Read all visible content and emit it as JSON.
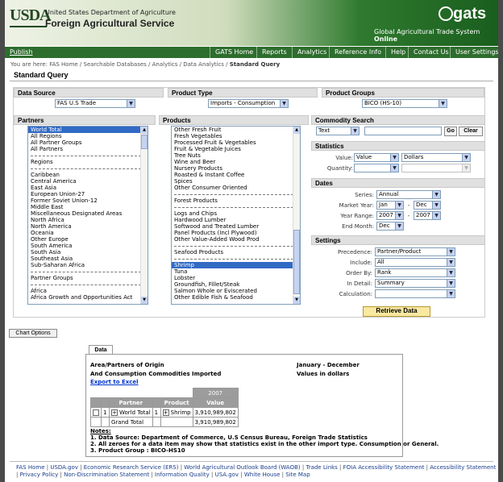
{
  "header": {
    "usda_logo_text": "USDA",
    "department": "United States Department of Agriculture",
    "agency": "Foreign Agricultural Service",
    "gats_logo_text": "gats",
    "gats_subtitle": "Global Agricultural Trade System",
    "gats_subtitle_bold": "Online",
    "brand_color": "#2d6d2d"
  },
  "nav": {
    "publish": "Publish",
    "items": [
      "GATS Home",
      "Reports",
      "Analytics",
      "Reference Info",
      "Help",
      "Contact Us",
      "User Settings"
    ]
  },
  "breadcrumb": {
    "prefix": "You are here: FAS Home / Searchable Databases / Analytics / Data Analytics / ",
    "current": "Standard Query"
  },
  "page_title": "Standard Query",
  "data_source": {
    "label": "Data Source",
    "value": "FAS U.S Trade"
  },
  "product_type": {
    "label": "Product Type",
    "value": "Imports - Consumption"
  },
  "product_groups": {
    "label": "Product Groups",
    "value": "BICO (HS-10)"
  },
  "partners": {
    "label": "Partners",
    "items": [
      "World Total",
      "All Regions",
      "All Partner Groups",
      "All Partners",
      "---",
      "Regions",
      "---",
      "Caribbean",
      "Central America",
      "East Asia",
      "European Union-27",
      "Former Soviet Union-12",
      "Middle East",
      "Miscellaneous Designated Areas",
      "North Africa",
      "North America",
      "Oceania",
      "Other Europe",
      "South America",
      "South Asia",
      "Southeast Asia",
      "Sub-Saharan Africa",
      "---",
      "Partner Groups",
      "---",
      "Africa",
      "Africa Growth and Opportunities Act"
    ],
    "selected": "World Total"
  },
  "products": {
    "label": "Products",
    "items": [
      "Other Fresh Fruit",
      "Fresh Vegetables",
      "Processed Fruit & Vegetables",
      "Fruit & Vegetable Juices",
      "Tree Nuts",
      "Wine and Beer",
      "Nursery Products",
      "Roasted & Instant Coffee",
      "Spices",
      "Other Consumer Oriented",
      "---",
      "Forest Products",
      "---",
      "Logs and Chips",
      "Hardwood Lumber",
      "Softwood and Treated Lumber",
      "Panel Products (Incl Plywood)",
      "Other Value-Added Wood Prod",
      "---",
      "Seafood Products",
      "---",
      "Shrimp",
      "Tuna",
      "Lobster",
      "Groundfish, Fillet/Steak",
      "Salmon Whole or Eviscerated",
      "Other Edible Fish & Seafood"
    ],
    "selected": "Shrimp"
  },
  "commodity_search": {
    "label": "Commodity Search",
    "type_value": "Text",
    "go": "Go",
    "clear": "Clear"
  },
  "statistics": {
    "label": "Statistics",
    "value_label": "Value:",
    "value": "Value",
    "unit": "Dollars",
    "quantity_label": "Quantity:"
  },
  "dates": {
    "label": "Dates",
    "series_label": "Series:",
    "series": "Annual",
    "market_year_label": "Market Year:",
    "month_from": "Jan",
    "month_to": "Dec",
    "year_range_label": "Year Range:",
    "year_from": "2007",
    "year_to": "2007",
    "end_month_label": "End Month:",
    "end_month": "Dec",
    "dash": "-"
  },
  "settings": {
    "label": "Settings",
    "precedence_label": "Precedence:",
    "precedence": "Partner/Product",
    "include_label": "Include:",
    "include": "All",
    "order_by_label": "Order By:",
    "order_by": "Rank",
    "in_detail_label": "In Detail:",
    "in_detail": "Summary",
    "calculation_label": "Calculation:"
  },
  "retrieve_button": "Retrieve Data",
  "chart_options_button": "Chart Options",
  "data_tab": "Data",
  "report": {
    "line1": "Area/Partners of Origin",
    "line2": "And Consumption Commodities Imported",
    "period": "January - December",
    "units": "Values in dollars",
    "export": "Export to Excel",
    "year": "2007",
    "col_partner": "Partner",
    "col_product": "Product",
    "col_value": "Value",
    "rows": [
      {
        "rank": "1",
        "partner": "World Total",
        "rank2": "1",
        "product": "Shrimp",
        "value": "3,910,989,802"
      },
      {
        "partner": "Grand Total",
        "value": "3,910,989,802"
      }
    ],
    "notes_title": "Notes:",
    "notes": [
      "1. Data Source: Department of Commerce, U.S Census Bureau, Foreign Trade Statistics",
      "2. All zeroes for a data item may show that statistics exist in the other import type. Consumption or General.",
      "3. Product Group : BICO-HS10"
    ]
  },
  "footer": {
    "links": [
      "FAS Home",
      "USDA.gov",
      "Economic Research Service (ERS)",
      "World Agricultural Outlook Board (WAOB)",
      "Trade Links",
      "FOIA Accessibility Statement",
      "Accessibility Statement",
      "Privacy Policy",
      "Non-Discrimination Statement",
      "Information Quality",
      "USA.gov",
      "White House",
      "Site Map"
    ]
  }
}
